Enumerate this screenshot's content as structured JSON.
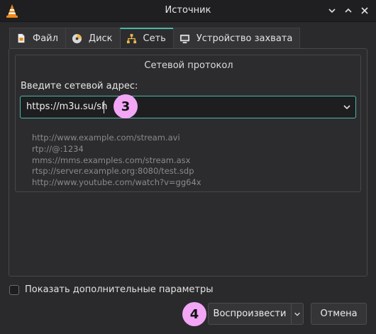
{
  "window": {
    "title": "Источник",
    "controls": [
      "minimize",
      "maximize",
      "close"
    ]
  },
  "tabs": [
    {
      "label": "Файл",
      "icon": "file-icon",
      "active": false
    },
    {
      "label": "Диск",
      "icon": "disc-icon",
      "active": false
    },
    {
      "label": "Сеть",
      "icon": "network-icon",
      "active": true
    },
    {
      "label": "Устройство захвата",
      "icon": "capture-device-icon",
      "active": false
    }
  ],
  "network": {
    "group_title": "Сетевой протокол",
    "address_label": "Введите сетевой адрес:",
    "address_value": "https://m3u.su/sh",
    "examples": [
      "http://www.example.com/stream.avi",
      "rtp://@:1234",
      "mms://mms.examples.com/stream.asx",
      "rtsp://server.example.org:8080/test.sdp",
      "http://www.youtube.com/watch?v=gg64x"
    ]
  },
  "options": {
    "show_more_label": "Показать дополнительные параметры",
    "checked": false
  },
  "buttons": {
    "play_label": "Воспроизвести",
    "cancel_label": "Отмена"
  },
  "annotations": {
    "step_address": "3",
    "step_play": "4"
  },
  "colors": {
    "accent": "#4bb8a6",
    "badge": "#f3a6f6",
    "vlc_orange": "#f08a1c"
  }
}
